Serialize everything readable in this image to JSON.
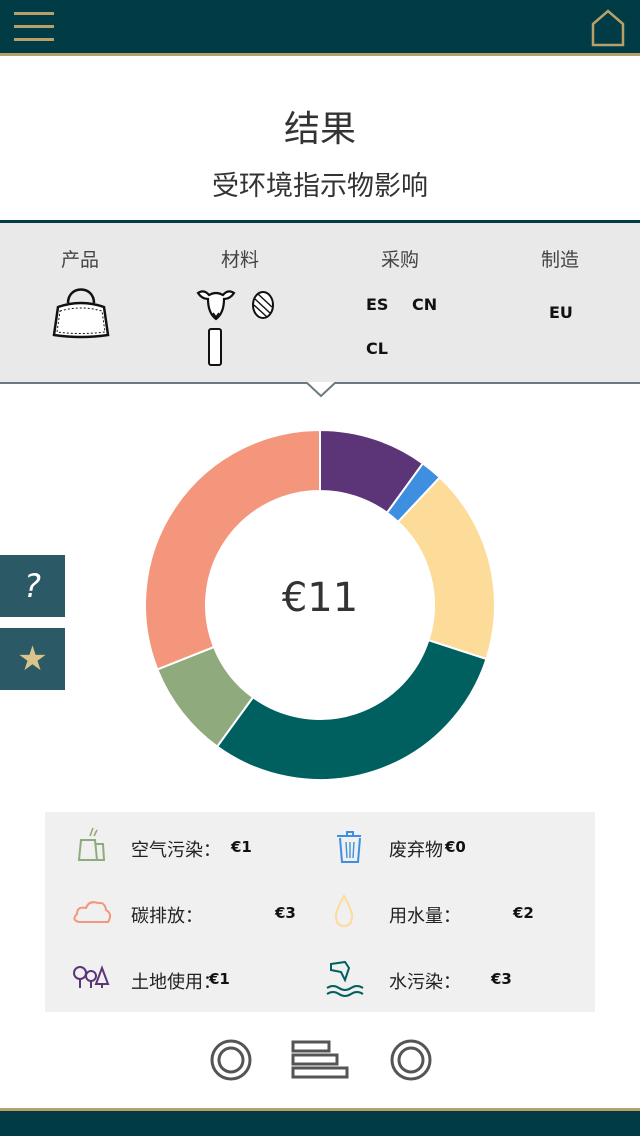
{
  "header": {
    "menu_icon": "hamburger-menu-icon",
    "home_icon": "home-icon",
    "accent": "#b8a06a",
    "bg": "#003b46"
  },
  "page": {
    "title": "结果",
    "subtitle": "受环境指示物影响"
  },
  "filters": {
    "product_label": "产品",
    "material_label": "材料",
    "sourcing_label": "采购",
    "manufacturing_label": "制造",
    "product_icon": "handbag-icon",
    "material_icons": [
      "sheep-icon",
      "yarn-ball-icon",
      "fabric-roll-icon"
    ],
    "sourcing_codes": [
      "ES",
      "CN",
      "CL"
    ],
    "manufacturing_codes": [
      "EU"
    ]
  },
  "side_buttons": {
    "help": "?",
    "favorite": "★"
  },
  "total": "€11",
  "chart_data": {
    "type": "pie",
    "donut": true,
    "center_label": "€11",
    "slices": [
      {
        "color": "#5b3578",
        "value": 10
      },
      {
        "color": "#3f8fe0",
        "value": 2
      },
      {
        "color": "#fcdc98",
        "value": 18
      },
      {
        "color": "#006060",
        "value": 30
      },
      {
        "color": "#8faa7c",
        "value": 9
      },
      {
        "color": "#f3967b",
        "value": 31
      }
    ]
  },
  "legend": [
    {
      "icon": "air-pollution-icon",
      "label": "空气污染：",
      "value": "€1",
      "color": "#8faa7c"
    },
    {
      "icon": "waste-bin-icon",
      "label": "废弃物",
      "value": "€0",
      "color": "#3f8fe0"
    },
    {
      "icon": "carbon-cloud-icon",
      "label": "碳排放：",
      "value": "€3",
      "color": "#f3967b"
    },
    {
      "icon": "water-drop-icon",
      "label": "用水量：",
      "value": "€2",
      "color": "#fcdc98"
    },
    {
      "icon": "land-use-trees-icon",
      "label": "土地使用：",
      "value": "€1",
      "color": "#5b3578"
    },
    {
      "icon": "water-pollution-icon",
      "label": "水污染：",
      "value": "€3",
      "color": "#006060"
    }
  ],
  "bottom_nav": [
    "donut-view-icon",
    "bar-view-icon",
    "ring-view-icon"
  ]
}
